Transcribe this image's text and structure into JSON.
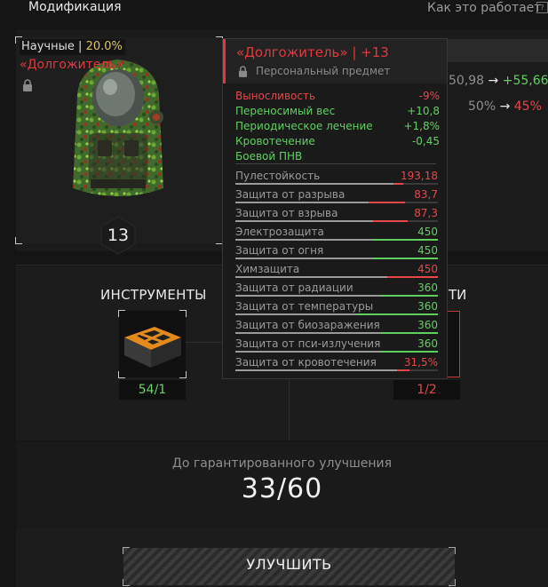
{
  "header": {
    "title": "Модификация",
    "how_it_works": "Как это работает",
    "help": "?"
  },
  "item": {
    "science_label": "Научные",
    "science_sep": "|",
    "science_value": "20.0%",
    "name": "«Долгожитель»",
    "level": "13"
  },
  "comparison": {
    "row1": {
      "from": "50,98",
      "arrow": "→",
      "to": "+55,66"
    },
    "row2": {
      "from": "50%",
      "arrow": "→",
      "to": "45%"
    }
  },
  "tooltip": {
    "title": "«Долгожитель» | +13",
    "subtitle": "Персональный предмет",
    "modifiers": [
      {
        "name": "Выносливость",
        "value": "-9%",
        "color": "#e5474b"
      },
      {
        "name": "Переносимый вес",
        "value": "+10,8",
        "color": "#5fd05f"
      },
      {
        "name": "Периодическое лечение",
        "value": "+1,8%",
        "color": "#5fd05f"
      },
      {
        "name": "Кровотечение",
        "value": "-0,45",
        "color": "#5fd05f"
      },
      {
        "name": "Боевой ПНВ",
        "value": "",
        "color": "#5fd05f"
      }
    ],
    "stats": [
      {
        "name": "Пулестойкость",
        "value": "193,18",
        "fill": 0.78,
        "delta": 0.05,
        "color": "#e5474b"
      },
      {
        "name": "Защита от разрыва",
        "value": "83,7",
        "fill": 0.66,
        "delta": 0.18,
        "color": "#e5474b"
      },
      {
        "name": "Защита от взрыва",
        "value": "87,3",
        "fill": 0.68,
        "delta": 0.17,
        "color": "#e5474b"
      },
      {
        "name": "Электрозащита",
        "value": "450",
        "fill": 0.68,
        "delta": 0.32,
        "color": "#5fd05f"
      },
      {
        "name": "Защита от огня",
        "value": "450",
        "fill": 0.68,
        "delta": 0.32,
        "color": "#5fd05f"
      },
      {
        "name": "Химзащита",
        "value": "450",
        "fill": 0.75,
        "delta": 0.25,
        "color": "#e5474b"
      },
      {
        "name": "Защита от радиации",
        "value": "360",
        "fill": 0.72,
        "delta": 0.28,
        "color": "#5fd05f"
      },
      {
        "name": "Защита от температуры",
        "value": "360",
        "fill": 0.6,
        "delta": 0.4,
        "color": "#5fd05f"
      },
      {
        "name": "Защита от биозаражения",
        "value": "360",
        "fill": 0.72,
        "delta": 0.28,
        "color": "#5fd05f"
      },
      {
        "name": "Защита от пси-излучения",
        "value": "360",
        "fill": 0.72,
        "delta": 0.28,
        "color": "#5fd05f"
      },
      {
        "name": "Защита от кровотечения",
        "value": "31,5%",
        "fill": 0.8,
        "delta": 0.06,
        "color": "#e5474b"
      }
    ]
  },
  "materials": {
    "tools_label": "ИНСТРУМЕНТЫ",
    "tools_count": "54/1",
    "second_label_visible": "ТИ",
    "second_count": "1/2"
  },
  "guarantee": {
    "label": "До гарантированного улучшения",
    "value": "33/60"
  },
  "upgrade_button": "УЛУЧШИТЬ",
  "colors": {
    "accent_red": "#e0393e",
    "positive": "#5fd05f",
    "science": "#d9c566"
  }
}
